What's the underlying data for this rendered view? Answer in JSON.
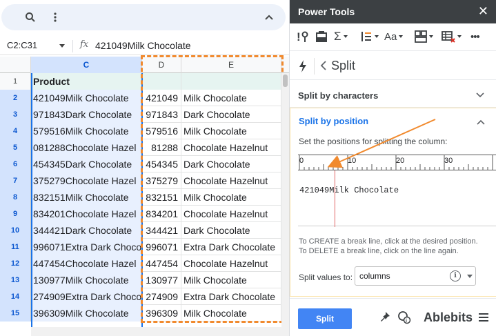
{
  "namebox": "C2:C31",
  "formula_value": "421049Milk Chocolate",
  "columns": {
    "c": "C",
    "d": "D",
    "e": "E"
  },
  "header_row": {
    "num": "1",
    "c": "Product",
    "d": "",
    "e": ""
  },
  "rows": [
    {
      "num": "2",
      "c": "421049Milk Chocolate",
      "d": "421049",
      "e": "Milk Chocolate"
    },
    {
      "num": "3",
      "c": "971843Dark Chocolate",
      "d": "971843",
      "e": "Dark Chocolate"
    },
    {
      "num": "4",
      "c": "579516Milk Chocolate",
      "d": "579516",
      "e": "Milk Chocolate"
    },
    {
      "num": "5",
      "c": "081288Chocolate Hazel",
      "d": "81288",
      "e": "Chocolate Hazelnut"
    },
    {
      "num": "6",
      "c": "454345Dark Chocolate",
      "d": "454345",
      "e": "Dark Chocolate"
    },
    {
      "num": "7",
      "c": "375279Chocolate Hazel",
      "d": "375279",
      "e": "Chocolate Hazelnut"
    },
    {
      "num": "8",
      "c": "832151Milk Chocolate",
      "d": "832151",
      "e": "Milk Chocolate"
    },
    {
      "num": "9",
      "c": "834201Chocolate Hazel",
      "d": "834201",
      "e": "Chocolate Hazelnut"
    },
    {
      "num": "10",
      "c": "344421Dark Chocolate",
      "d": "344421",
      "e": "Dark Chocolate"
    },
    {
      "num": "11",
      "c": "996071Extra Dark Choco",
      "d": "996071",
      "e": "Extra Dark Chocolate"
    },
    {
      "num": "12",
      "c": "447454Chocolate Hazel",
      "d": "447454",
      "e": "Chocolate Hazelnut"
    },
    {
      "num": "13",
      "c": "130977Milk Chocolate",
      "d": "130977",
      "e": "Milk Chocolate"
    },
    {
      "num": "14",
      "c": "274909Extra Dark Choco",
      "d": "274909",
      "e": "Extra Dark Chocolate"
    },
    {
      "num": "15",
      "c": "396309Milk Chocolate",
      "d": "396309",
      "e": "Milk Chocolate"
    }
  ],
  "panel": {
    "title": "Power Tools",
    "close": "✕",
    "toolbar": {
      "sigma": "Σ",
      "font": "Aa",
      "more": "•••"
    },
    "split_title": "Split",
    "section1": "Split by characters",
    "section2": "Split by position",
    "instruction": "Set the positions for splitting the column:",
    "ruler": [
      "0",
      "10",
      "20",
      "30"
    ],
    "sample": "421049Milk Chocolate",
    "hint1": "To CREATE a break line, click at the desired position.",
    "hint2": "To DELETE a break line, click on the line again.",
    "split_values_label": "Split values to:",
    "split_values_value": "columns",
    "info": "i",
    "split_button": "Split",
    "brand": "Ablebits"
  },
  "colors": {
    "accent": "#1a73e8",
    "highlight": "#f18a2e",
    "button": "#4285f4"
  }
}
